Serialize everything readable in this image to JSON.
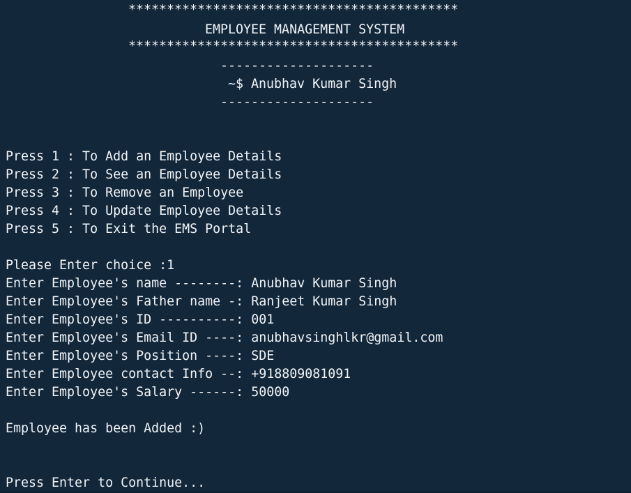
{
  "header": {
    "stars_top": "*******************************************",
    "title": "EMPLOYEE MANAGEMENT SYSTEM",
    "stars_bottom": "*******************************************",
    "dash_top": "--------------------",
    "author": "~$ Anubhav Kumar Singh",
    "dash_bottom": "--------------------"
  },
  "menu": {
    "options": [
      "Press 1 : To Add an Employee Details",
      "Press 2 : To See an Employee Details",
      "Press 3 : To Remove an Employee",
      "Press 4 : To Update Employee Details",
      "Press 5 : To Exit the EMS Portal"
    ]
  },
  "session": {
    "choice_prompt": "Please Enter choice :1",
    "fields": [
      "Enter Employee's name --------: Anubhav Kumar Singh",
      "Enter Employee's Father name -: Ranjeet Kumar Singh",
      "Enter Employee's ID ----------: 001",
      "Enter Employee's Email ID ----: anubhavsinghlkr@gmail.com",
      "Enter Employee's Position ----: SDE",
      "Enter Employee contact Info --: +918809081091",
      "Enter Employee's Salary ------: 50000"
    ],
    "result": "Employee has been Added :)",
    "continue_prompt": "Press Enter to Continue..."
  }
}
